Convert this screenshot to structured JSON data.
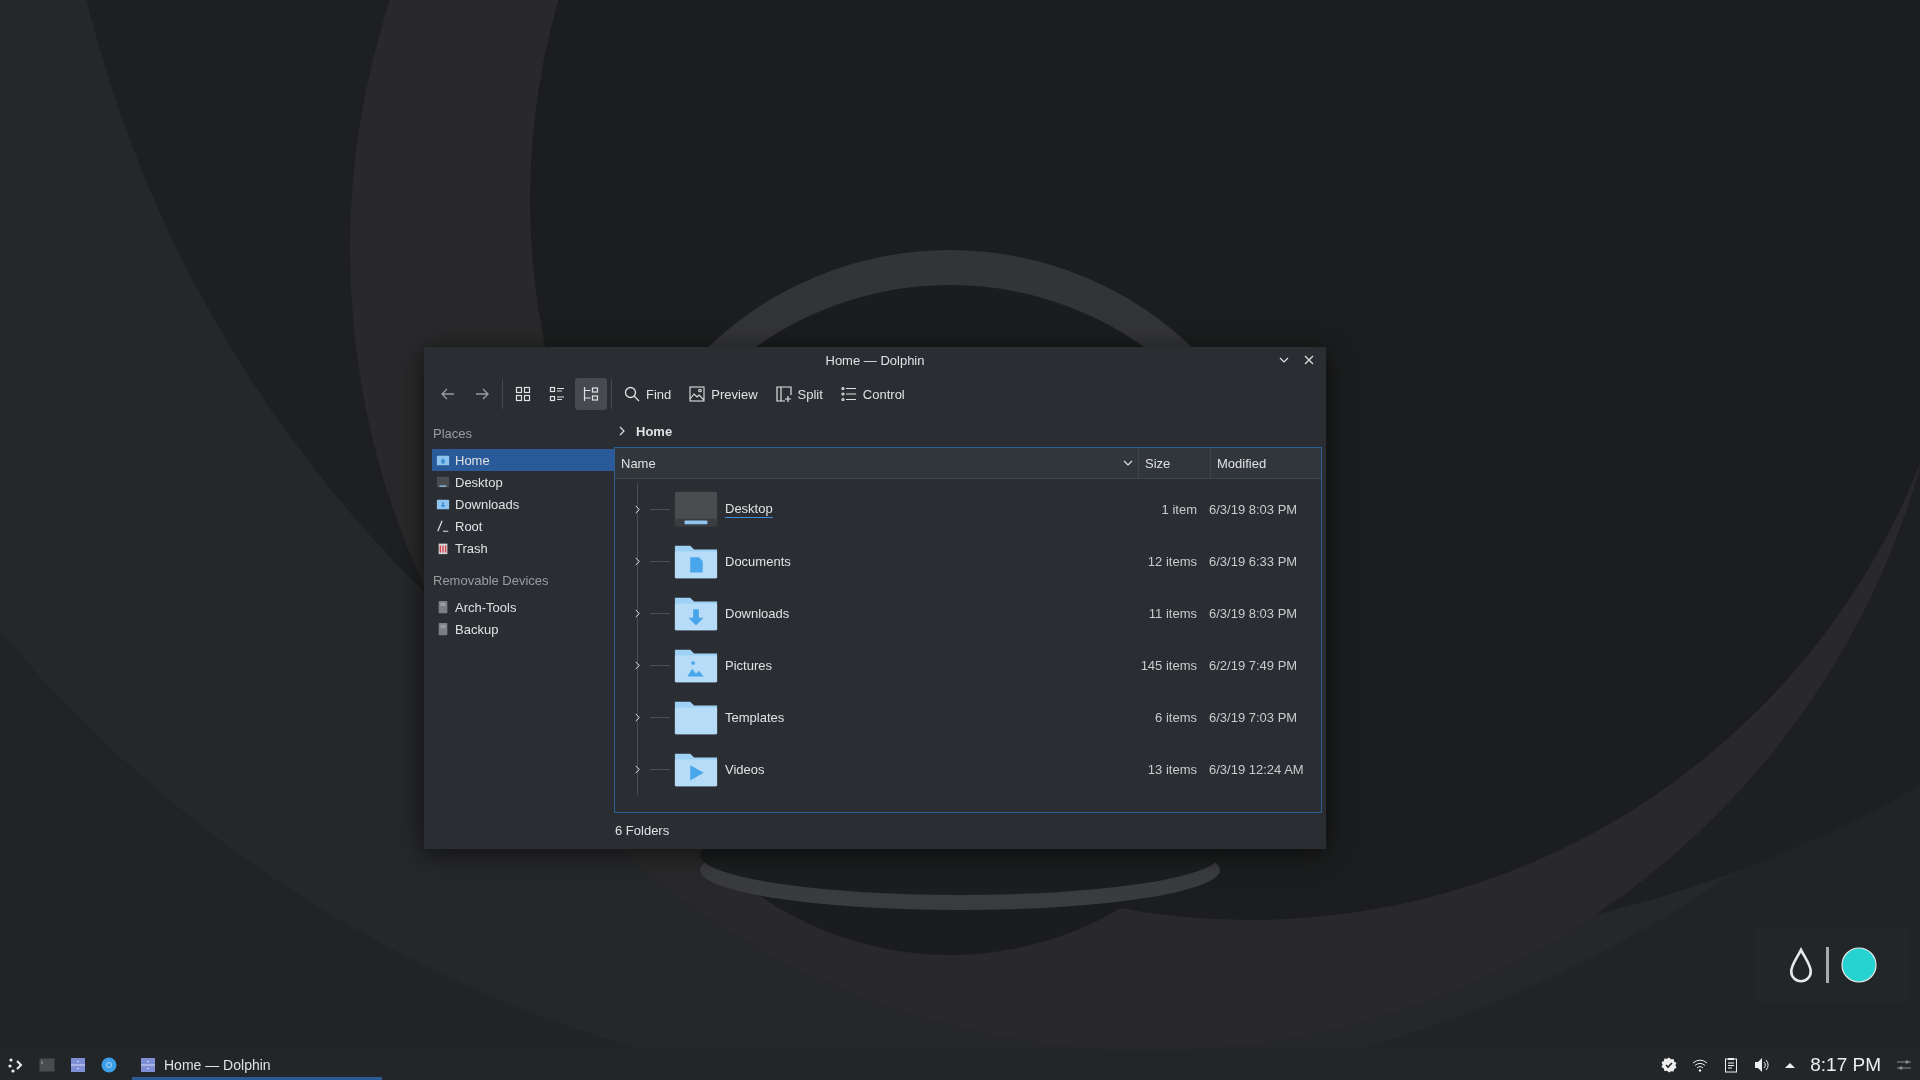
{
  "window": {
    "title": "Home — Dolphin"
  },
  "toolbar": {
    "nav": [
      {
        "kind": "back"
      },
      {
        "kind": "forward"
      }
    ],
    "view_modes": [
      {
        "kind": "icons",
        "selected": false
      },
      {
        "kind": "compact",
        "selected": false
      },
      {
        "kind": "details",
        "selected": true
      }
    ],
    "actions": [
      {
        "kind": "find",
        "label": "Find"
      },
      {
        "kind": "preview",
        "label": "Preview"
      },
      {
        "kind": "split",
        "label": "Split"
      },
      {
        "kind": "control",
        "label": "Control"
      }
    ]
  },
  "places": {
    "heading": "Places",
    "items": [
      {
        "label": "Home",
        "kind": "home",
        "selected": true
      },
      {
        "label": "Desktop",
        "kind": "desktop",
        "selected": false
      },
      {
        "label": "Downloads",
        "kind": "downloads",
        "selected": false
      },
      {
        "label": "Root",
        "kind": "root",
        "selected": false
      },
      {
        "label": "Trash",
        "kind": "trash",
        "selected": false
      }
    ]
  },
  "removable": {
    "heading": "Removable Devices",
    "items": [
      {
        "label": "Arch-Tools",
        "kind": "drive",
        "selected": false
      },
      {
        "label": "Backup",
        "kind": "drive",
        "selected": false
      }
    ]
  },
  "breadcrumb": [
    "Home"
  ],
  "table": {
    "columns": [
      "Name",
      "Size",
      "Modified"
    ],
    "rows": [
      {
        "name": "Desktop",
        "kind": "desktop",
        "size": "1 item",
        "modified": "6/3/19 8:03 PM",
        "expanded": false,
        "hovered": true
      },
      {
        "name": "Documents",
        "kind": "documents",
        "size": "12 items",
        "modified": "6/3/19 6:33 PM",
        "expanded": false,
        "hovered": false
      },
      {
        "name": "Downloads",
        "kind": "downloads",
        "size": "11 items",
        "modified": "6/3/19 8:03 PM",
        "expanded": false,
        "hovered": false
      },
      {
        "name": "Pictures",
        "kind": "pictures",
        "size": "145 items",
        "modified": "6/2/19 7:49 PM",
        "expanded": false,
        "hovered": false
      },
      {
        "name": "Templates",
        "kind": "templates",
        "size": "6 items",
        "modified": "6/3/19 7:03 PM",
        "expanded": false,
        "hovered": false
      },
      {
        "name": "Videos",
        "kind": "videos",
        "size": "13 items",
        "modified": "6/3/19 12:24 AM",
        "expanded": false,
        "hovered": false
      }
    ]
  },
  "status_bar": "6 Folders",
  "taskbar": {
    "launchers": [
      {
        "kind": "menu"
      },
      {
        "kind": "terminal"
      },
      {
        "kind": "files"
      },
      {
        "kind": "browser"
      }
    ],
    "tasks": [
      {
        "label": "Home — Dolphin",
        "selected": true
      }
    ],
    "tray": [
      {
        "kind": "updates"
      },
      {
        "kind": "wifi"
      },
      {
        "kind": "clipboard"
      },
      {
        "kind": "volume"
      },
      {
        "kind": "expand"
      }
    ],
    "clock": "8:17 PM"
  }
}
